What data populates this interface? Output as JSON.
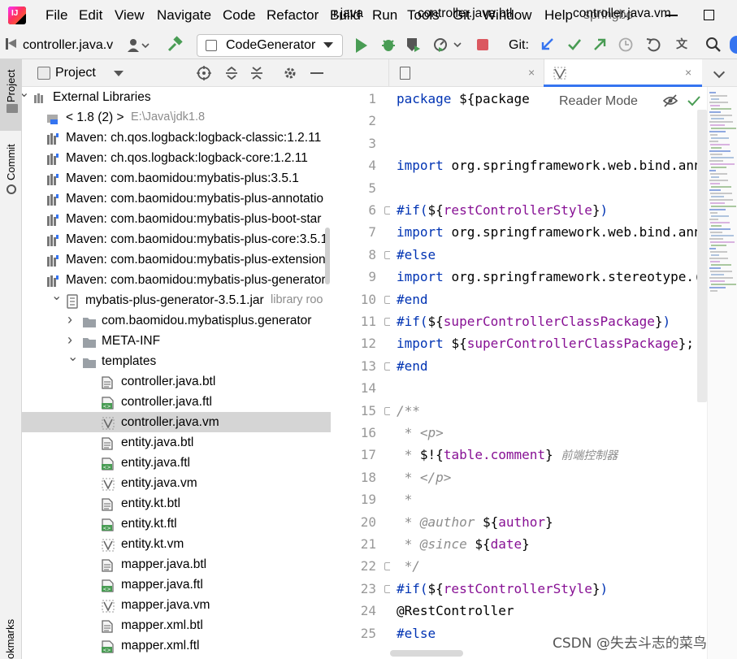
{
  "menubar": {
    "items": [
      "File",
      "Edit",
      "View",
      "Navigate",
      "Code",
      "Refactor",
      "Build",
      "Run",
      "Tools",
      "Git",
      "Window",
      "Help"
    ],
    "project_name": "springbo",
    "window_controls": [
      "minimize",
      "maximize"
    ]
  },
  "toolbar": {
    "breadcrumb_file": "controller.java.v",
    "run_config": "CodeGenerator",
    "git_label": "Git:"
  },
  "left_strip": {
    "project_label": "Project",
    "commit_label": "Commit",
    "bookmarks_label": "okmarks"
  },
  "project_panel": {
    "title": "Project"
  },
  "tree": {
    "rows": [
      {
        "label": "External Libraries",
        "extra": "",
        "icon": "library-icon"
      },
      {
        "label": "< 1.8 (2) >",
        "extra": "E:\\Java\\jdk1.8",
        "icon": "jdk-icon"
      },
      {
        "label": "Maven: ch.qos.logback:logback-classic:1.2.11",
        "extra": "",
        "icon": "maven-library-icon"
      },
      {
        "label": "Maven: ch.qos.logback:logback-core:1.2.11",
        "extra": "",
        "icon": "maven-library-icon"
      },
      {
        "label": "Maven: com.baomidou:mybatis-plus:3.5.1",
        "extra": "",
        "icon": "maven-library-icon"
      },
      {
        "label": "Maven: com.baomidou:mybatis-plus-annotatio",
        "extra": "",
        "icon": "maven-library-icon"
      },
      {
        "label": "Maven: com.baomidou:mybatis-plus-boot-star",
        "extra": "",
        "icon": "maven-library-icon"
      },
      {
        "label": "Maven: com.baomidou:mybatis-plus-core:3.5.1",
        "extra": "",
        "icon": "maven-library-icon"
      },
      {
        "label": "Maven: com.baomidou:mybatis-plus-extension",
        "extra": "",
        "icon": "maven-library-icon"
      },
      {
        "label": "Maven: com.baomidou:mybatis-plus-generator",
        "extra": "",
        "icon": "maven-library-icon"
      },
      {
        "label": "mybatis-plus-generator-3.5.1.jar",
        "extra": "library roo",
        "icon": "jar-icon"
      },
      {
        "label": "com.baomidou.mybatisplus.generator",
        "extra": "",
        "icon": "package-icon"
      },
      {
        "label": "META-INF",
        "extra": "",
        "icon": "folder-icon"
      },
      {
        "label": "templates",
        "extra": "",
        "icon": "folder-icon"
      },
      {
        "label": "controller.java.btl",
        "extra": "",
        "icon": "text-file-icon"
      },
      {
        "label": "controller.java.ftl",
        "extra": "",
        "icon": "freemarker-file-icon"
      },
      {
        "label": "controller.java.vm",
        "extra": "",
        "icon": "velocity-file-icon"
      },
      {
        "label": "entity.java.btl",
        "extra": "",
        "icon": "text-file-icon"
      },
      {
        "label": "entity.java.ftl",
        "extra": "",
        "icon": "freemarker-file-icon"
      },
      {
        "label": "entity.java.vm",
        "extra": "",
        "icon": "velocity-file-icon"
      },
      {
        "label": "entity.kt.btl",
        "extra": "",
        "icon": "text-file-icon"
      },
      {
        "label": "entity.kt.ftl",
        "extra": "",
        "icon": "freemarker-file-icon"
      },
      {
        "label": "entity.kt.vm",
        "extra": "",
        "icon": "velocity-file-icon"
      },
      {
        "label": "mapper.java.btl",
        "extra": "",
        "icon": "text-file-icon"
      },
      {
        "label": "mapper.java.ftl",
        "extra": "",
        "icon": "freemarker-file-icon"
      },
      {
        "label": "mapper.java.vm",
        "extra": "",
        "icon": "velocity-file-icon"
      },
      {
        "label": "mapper.xml.btl",
        "extra": "",
        "icon": "text-file-icon"
      },
      {
        "label": "mapper.xml.ftl",
        "extra": "",
        "icon": "freemarker-file-icon"
      }
    ],
    "selected_label": "controller.java.vm"
  },
  "editor_tabs": [
    {
      "label": "r.java",
      "active": false
    },
    {
      "label": "controller.java.btl",
      "active": false
    },
    {
      "label": "controller.java.vm",
      "active": true
    }
  ],
  "reader_mode": "Reader Mode",
  "code_lines": [
    {
      "n": "1",
      "parts": [
        [
          "kw",
          "package "
        ],
        [
          "var",
          "${package"
        ]
      ]
    },
    {
      "n": "2",
      "parts": []
    },
    {
      "n": "3",
      "parts": []
    },
    {
      "n": "4",
      "parts": [
        [
          "kw",
          "import "
        ],
        [
          "var",
          "org.springframework.web.bind.ann"
        ]
      ]
    },
    {
      "n": "5",
      "parts": []
    },
    {
      "n": "6",
      "parts": [
        [
          "dir",
          "#if("
        ],
        [
          "var",
          "${"
        ],
        [
          "var2",
          "restControllerStyle"
        ],
        [
          "var",
          "}"
        ],
        [
          "dir",
          ")"
        ]
      ]
    },
    {
      "n": "7",
      "parts": [
        [
          "kw",
          "import "
        ],
        [
          "var",
          "org.springframework.web.bind.ann"
        ]
      ]
    },
    {
      "n": "8",
      "parts": [
        [
          "dir",
          "#else"
        ]
      ]
    },
    {
      "n": "9",
      "parts": [
        [
          "kw",
          "import "
        ],
        [
          "var",
          "org.springframework.stereotype.("
        ]
      ]
    },
    {
      "n": "10",
      "parts": [
        [
          "dir",
          "#end"
        ]
      ]
    },
    {
      "n": "11",
      "parts": [
        [
          "dir",
          "#if("
        ],
        [
          "var",
          "${"
        ],
        [
          "var2",
          "superControllerClassPackage"
        ],
        [
          "var",
          "}"
        ],
        [
          "dir",
          ")"
        ]
      ]
    },
    {
      "n": "12",
      "parts": [
        [
          "kw",
          "import "
        ],
        [
          "var",
          "${"
        ],
        [
          "var2",
          "superControllerClassPackage"
        ],
        [
          "var",
          "};"
        ]
      ]
    },
    {
      "n": "13",
      "parts": [
        [
          "dir",
          "#end"
        ]
      ]
    },
    {
      "n": "14",
      "parts": []
    },
    {
      "n": "15",
      "parts": [
        [
          "cm",
          "/**"
        ]
      ]
    },
    {
      "n": "16",
      "parts": [
        [
          "cm",
          " * "
        ],
        [
          "tag",
          "<p>"
        ]
      ]
    },
    {
      "n": "17",
      "parts": [
        [
          "cm",
          " * "
        ],
        [
          "var",
          "$!{"
        ],
        [
          "var2",
          "table.comment"
        ],
        [
          "var",
          "} "
        ],
        [
          "zh",
          "前端控制器"
        ]
      ]
    },
    {
      "n": "18",
      "parts": [
        [
          "cm",
          " * "
        ],
        [
          "tag",
          "</p>"
        ]
      ]
    },
    {
      "n": "19",
      "parts": [
        [
          "cm",
          " *"
        ]
      ]
    },
    {
      "n": "20",
      "parts": [
        [
          "cm",
          " * "
        ],
        [
          "tag",
          "@author"
        ],
        [
          "var",
          " ${"
        ],
        [
          "var2",
          "author"
        ],
        [
          "var",
          "}"
        ]
      ]
    },
    {
      "n": "21",
      "parts": [
        [
          "cm",
          " * "
        ],
        [
          "tag",
          "@since"
        ],
        [
          "var",
          " ${"
        ],
        [
          "var2",
          "date"
        ],
        [
          "var",
          "}"
        ]
      ]
    },
    {
      "n": "22",
      "parts": [
        [
          "cm",
          " */"
        ]
      ]
    },
    {
      "n": "23",
      "parts": [
        [
          "dir",
          "#if("
        ],
        [
          "var",
          "${"
        ],
        [
          "var2",
          "restControllerStyle"
        ],
        [
          "var",
          "}"
        ],
        [
          "dir",
          ")"
        ]
      ]
    },
    {
      "n": "24",
      "parts": [
        [
          "var",
          "@RestController"
        ]
      ]
    },
    {
      "n": "25",
      "parts": [
        [
          "dir",
          "#else"
        ]
      ]
    }
  ],
  "watermark": "CSDN @失去斗志的菜鸟"
}
